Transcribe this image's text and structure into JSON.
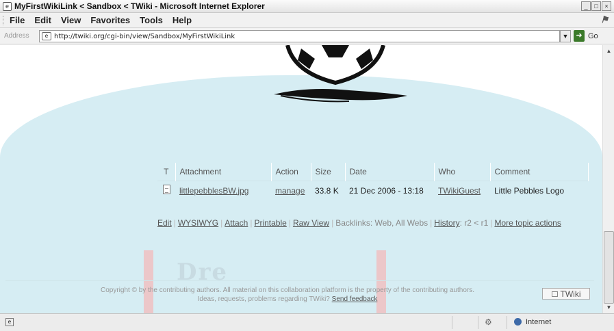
{
  "window": {
    "title": "MyFirstWikiLink < Sandbox < TWiki - Microsoft Internet Explorer",
    "controls": {
      "minimize": "_",
      "maximize": "□",
      "close": "×"
    }
  },
  "menu": {
    "items": [
      "File",
      "Edit",
      "View",
      "Favorites",
      "Tools",
      "Help"
    ]
  },
  "address": {
    "label": "Address",
    "url": "http://twiki.org/cgi-bin/view/Sandbox/MyFirstWikiLink",
    "go_label": "Go"
  },
  "attachments": {
    "headers": [
      "T",
      "Attachment",
      "Action",
      "Size",
      "Date",
      "Who",
      "Comment"
    ],
    "rows": [
      {
        "name": "littlepebblesBW.jpg",
        "action": "manage",
        "size": "33.8 K",
        "date": "21 Dec 2006 - 13:18",
        "who": "TWikiGuest",
        "comment": "Little Pebbles Logo"
      }
    ]
  },
  "topic_actions": {
    "edit": "Edit",
    "wysiwyg": "WYSIWYG",
    "attach": "Attach",
    "printable": "Printable",
    "raw_view": "Raw View",
    "backlinks": "Backlinks: Web, All Webs",
    "history": "History",
    "revision": "r2 < r1",
    "more": "More topic actions"
  },
  "footer": {
    "line1": "Copyright © by the contributing authors. All material on this collaboration platform is the property of the contributing authors.",
    "line2_prefix": "Ideas, requests, problems regarding TWiki?",
    "feedback_link": "Send feedback",
    "badge": "TWiki"
  },
  "statusbar": {
    "zone": "Internet"
  },
  "colors": {
    "watermark_blue": "#d6edf3",
    "watermark_pink": "#ecc7c9"
  }
}
